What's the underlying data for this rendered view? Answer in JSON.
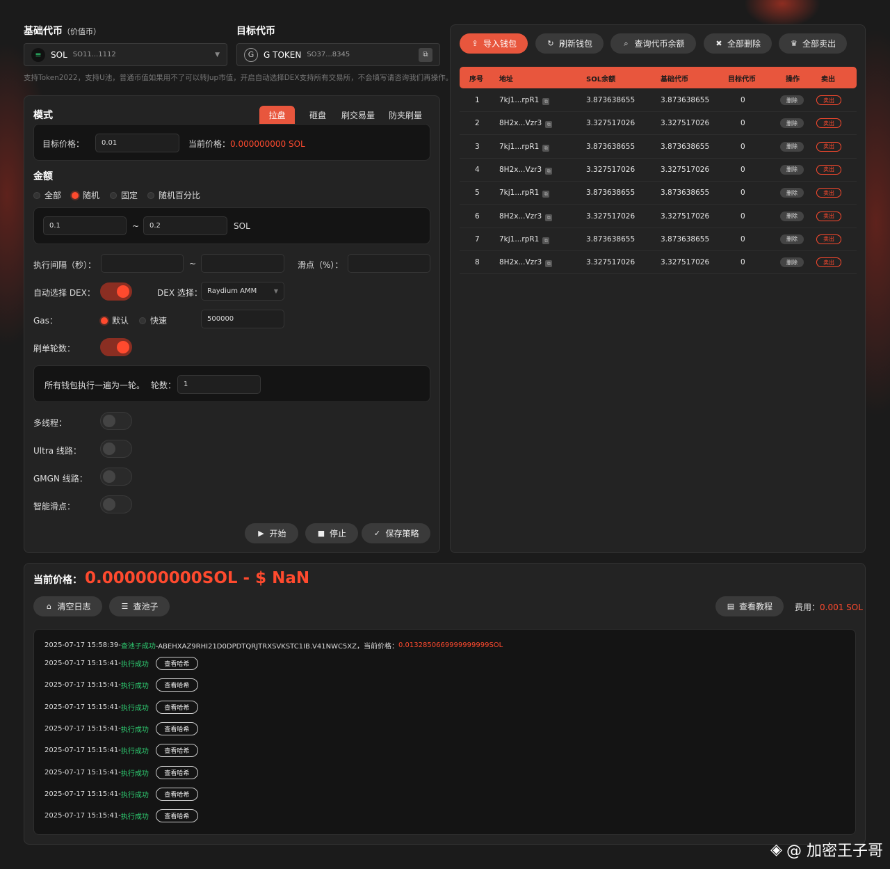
{
  "base": {
    "title": "基础代币",
    "subtitle": "（价值币）",
    "symbol": "SOL",
    "address": "SO11...1112"
  },
  "target": {
    "title": "目标代币",
    "symbol": "G TOKEN",
    "address": "SO37...8345"
  },
  "note": "支持Token2022，支持U池，普通币值如果用不了可以转Jup市值，开启自动选择DEX支持所有交易所，不会填写请咨询我们再操作。",
  "mode": {
    "title": "模式",
    "tabs": [
      "拉盘",
      "砸盘",
      "刷交易量",
      "防夹刷量"
    ],
    "target_price_label": "目标价格：",
    "target_price_value": "0.01",
    "current_price_label": "当前价格：",
    "current_price_value": "0.000000000 SOL"
  },
  "amount": {
    "title": "金额",
    "options": [
      "全部",
      "随机",
      "固定",
      "随机百分比"
    ],
    "min": "0.1",
    "tilde": "~",
    "max": "0.2",
    "unit": "SOL"
  },
  "interval_label": "执行间隔（秒）：",
  "interval_tilde": "~",
  "slippage_label": "滑点（%）：",
  "auto_dex_label": "自动选择 DEX：",
  "dex_select_label": "DEX 选择：",
  "dex_value": "Raydium AMM",
  "gas": {
    "label": "Gas：",
    "options": [
      "默认",
      "快速"
    ],
    "value": "500000"
  },
  "rounds": {
    "label": "刷单轮数：",
    "desc": "所有钱包执行一遍为一轮。",
    "count_label": "轮数：",
    "count_value": "1"
  },
  "toggles": {
    "multi": "多线程：",
    "ultra": "Ultra 线路：",
    "gmgn": "GMGN 线路：",
    "smart": "智能滑点："
  },
  "actions": {
    "start": "开始",
    "stop": "停止",
    "save": "保存策略"
  },
  "wallet_actions": {
    "import": "导入钱包",
    "refresh": "刷新钱包",
    "query": "查询代币余额",
    "delete_all": "全部删除",
    "sell_all": "全部卖出"
  },
  "table": {
    "headers": [
      "序号",
      "地址",
      "SOL余额",
      "基础代币",
      "目标代币",
      "操作",
      "卖出"
    ],
    "delete_label": "删除",
    "sell_label": "卖出",
    "rows": [
      {
        "no": "1",
        "addr": "7kj1...rpR1",
        "sol": "3.873638655",
        "base": "3.873638655",
        "target": "0"
      },
      {
        "no": "2",
        "addr": "8H2x...Vzr3",
        "sol": "3.327517026",
        "base": "3.327517026",
        "target": "0"
      },
      {
        "no": "3",
        "addr": "7kj1...rpR1",
        "sol": "3.873638655",
        "base": "3.873638655",
        "target": "0"
      },
      {
        "no": "4",
        "addr": "8H2x...Vzr3",
        "sol": "3.327517026",
        "base": "3.327517026",
        "target": "0"
      },
      {
        "no": "5",
        "addr": "7kj1...rpR1",
        "sol": "3.873638655",
        "base": "3.873638655",
        "target": "0"
      },
      {
        "no": "6",
        "addr": "8H2x...Vzr3",
        "sol": "3.327517026",
        "base": "3.327517026",
        "target": "0"
      },
      {
        "no": "7",
        "addr": "7kj1...rpR1",
        "sol": "3.873638655",
        "base": "3.873638655",
        "target": "0"
      },
      {
        "no": "8",
        "addr": "8H2x...Vzr3",
        "sol": "3.327517026",
        "base": "3.327517026",
        "target": "0"
      }
    ]
  },
  "bottom": {
    "price_label": "当前价格：",
    "price_value": "0.000000000SOL - $ NaN",
    "clear_log": "清空日志",
    "check_pool": "查池子",
    "tutorial": "查看教程",
    "fee_label": "费用：",
    "fee_value": "0.001 SOL"
  },
  "log": {
    "first": {
      "time": "2025-07-17 15:58:39-",
      "status": "查池子成功",
      "rest": "-ABEHXAZ9RHI21D0DPDTQRJTRXSVKSTC1IB.V41NWC5XZ，当前价格：",
      "price": "0.0132850669999999999SOL"
    },
    "hash_label": "查看哈希",
    "entries": [
      {
        "time": "2025-07-17 15:15:41-",
        "status": "执行成功"
      },
      {
        "time": "2025-07-17 15:15:41-",
        "status": "执行成功"
      },
      {
        "time": "2025-07-17 15:15:41-",
        "status": "执行成功"
      },
      {
        "time": "2025-07-17 15:15:41-",
        "status": "执行成功"
      },
      {
        "time": "2025-07-17 15:15:41-",
        "status": "执行成功"
      },
      {
        "time": "2025-07-17 15:15:41-",
        "status": "执行成功"
      },
      {
        "time": "2025-07-17 15:15:41-",
        "status": "执行成功"
      },
      {
        "time": "2025-07-17 15:15:41-",
        "status": "执行成功"
      }
    ]
  },
  "watermark": "@ 加密王子哥",
  "colors": {
    "accent": "#e8563d",
    "danger": "#ff4a2e",
    "success": "#2ecc71",
    "bg": "#1b1b1b"
  },
  "icons": [
    "menu-icon",
    "chevron-down-icon",
    "copy-icon",
    "upload-icon",
    "refresh-icon",
    "search-icon",
    "trash-icon",
    "crown-icon",
    "play-icon",
    "stop-icon",
    "check-icon",
    "broom-icon",
    "database-icon",
    "book-icon"
  ]
}
